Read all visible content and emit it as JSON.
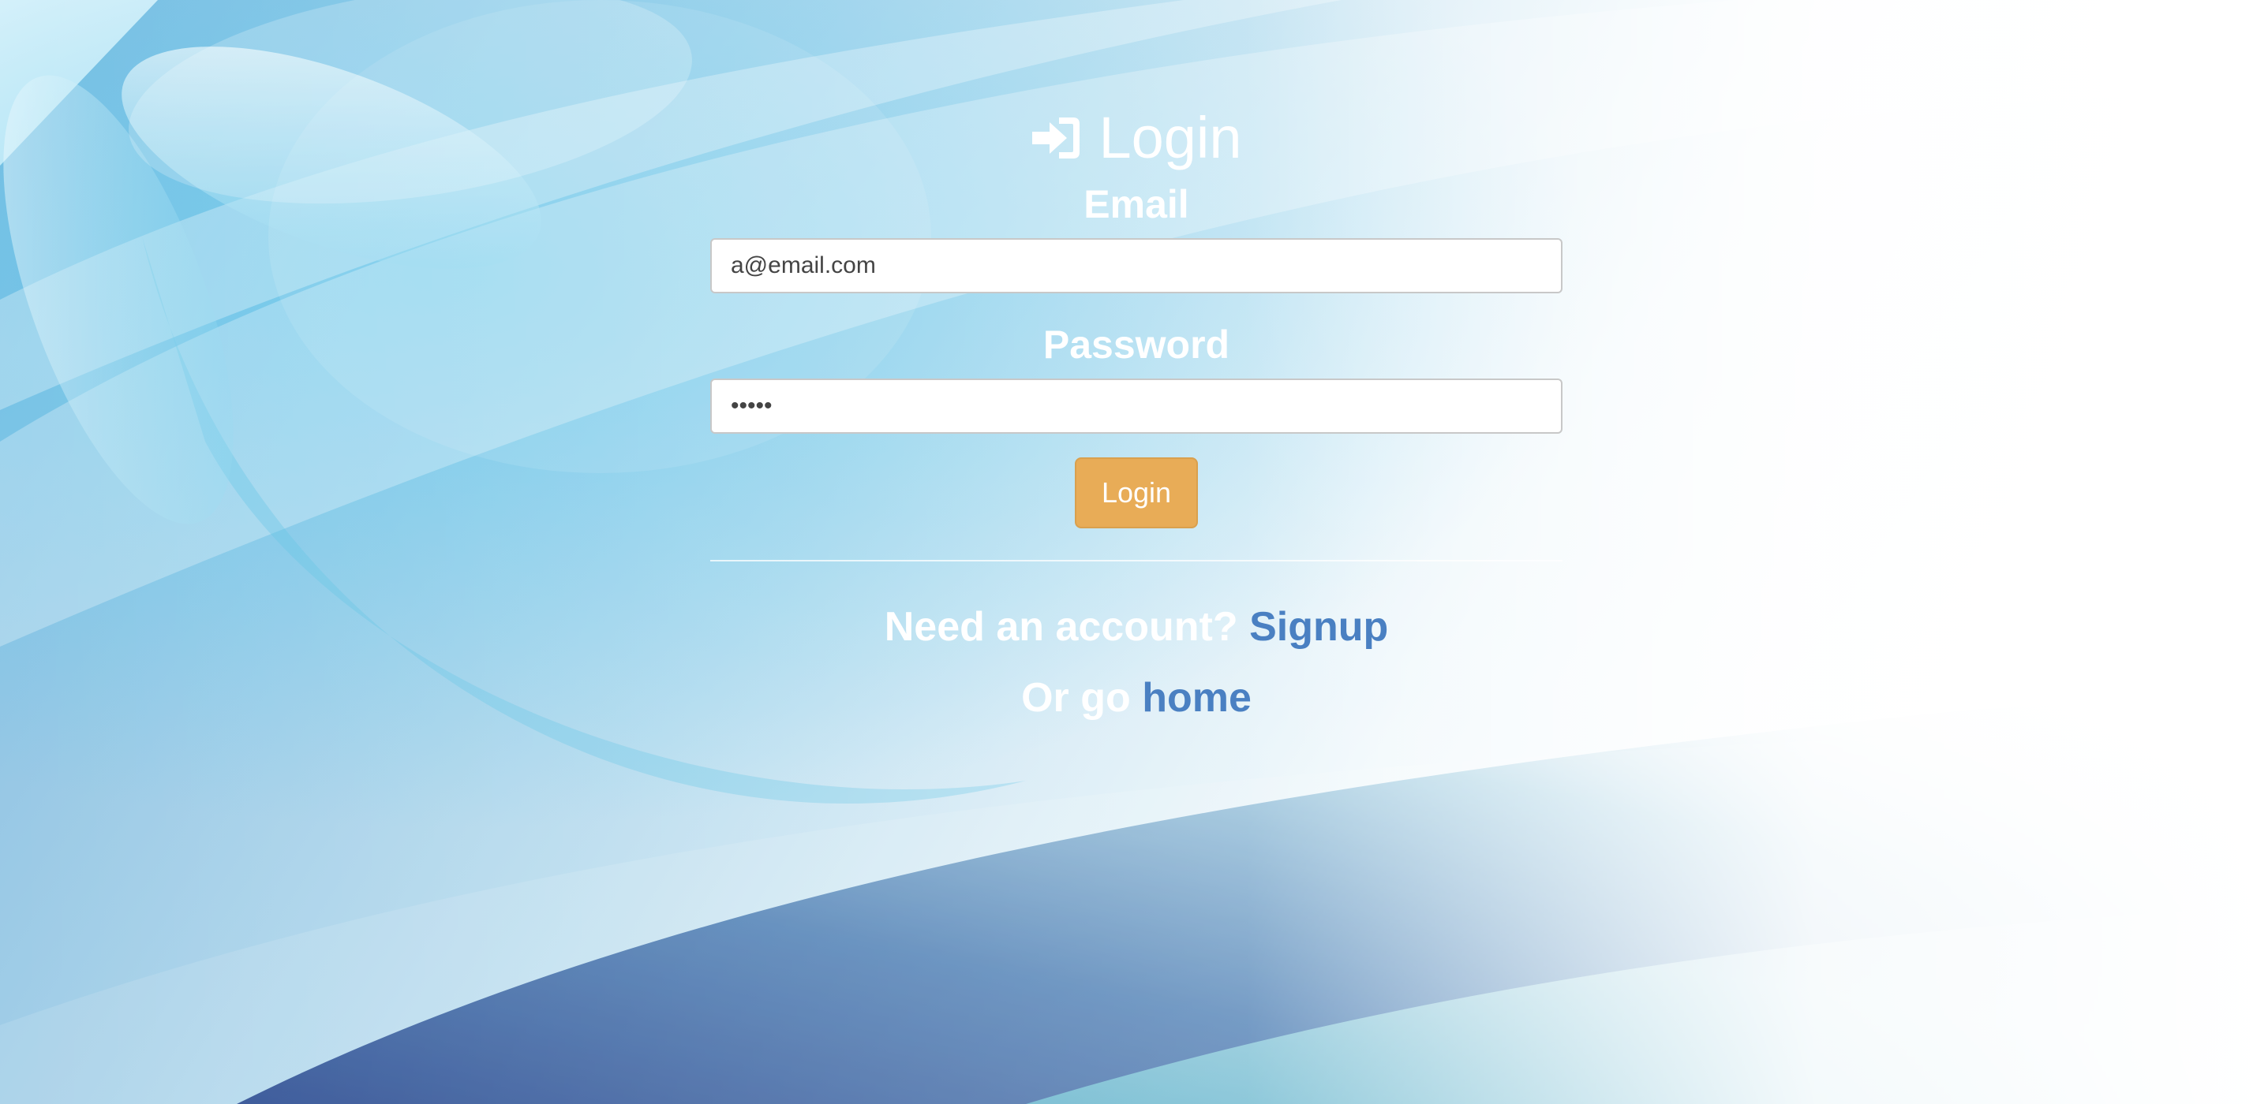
{
  "login": {
    "title": "Login",
    "email_label": "Email",
    "email_value": "a@email.com",
    "password_label": "Password",
    "password_value": "•••••",
    "submit_label": "Login"
  },
  "footer": {
    "signup_prompt": "Need an account?",
    "signup_link": "Signup",
    "home_prompt": "Or go",
    "home_link": "home"
  },
  "icons": {
    "title_icon": "sign-in-icon"
  },
  "colors": {
    "button": "#e8ac57",
    "link": "#4a80c2",
    "text": "#ffffff"
  }
}
